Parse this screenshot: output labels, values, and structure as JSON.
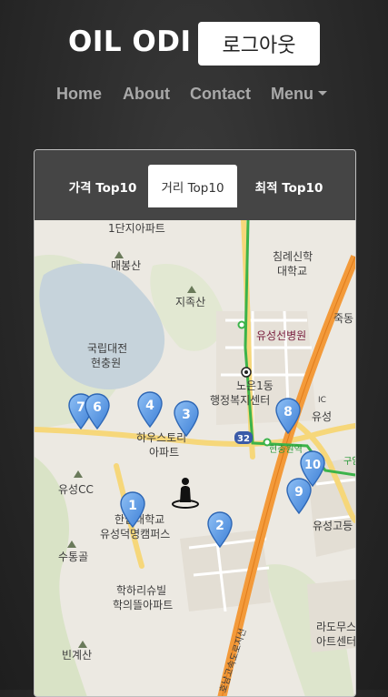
{
  "header": {
    "brand": "OIL ODI",
    "logout_label": "로그아웃"
  },
  "nav": {
    "items": [
      "Home",
      "About",
      "Contact"
    ],
    "menu_label": "Menu"
  },
  "tabs": [
    {
      "label": "가격 Top10",
      "active": false
    },
    {
      "label": "거리 Top10",
      "active": true
    },
    {
      "label": "최적 Top10",
      "active": false
    }
  ],
  "map": {
    "labels": {
      "apt_top": "1단지아파트",
      "mt_maebong": "매봉산",
      "mt_jijok": "지족산",
      "cemetery_1": "국립대전",
      "cemetery_2": "현충원",
      "seminary_1": "침례신학",
      "seminary_2": "대학교",
      "hospital": "유성선병원",
      "jukdong": "죽동",
      "noeun_1": "노은1동",
      "noeun_2": "행정복지센터",
      "ic": "IC",
      "yuseong": "유성",
      "haust_1": "하우스토리",
      "haust_2": "아파트",
      "road_num": "32",
      "station": "현충원역",
      "station2": "구암역",
      "yuseong_cc": "유성CC",
      "univ_1": "한밭대학교",
      "univ_2": "유성덕명캠퍼스",
      "sutonggol": "수통골",
      "hs": "유성고등",
      "hakhari_1": "학하리슈빌",
      "hakhari_2": "학의뜰아파트",
      "bingye": "빈계산",
      "expressway": "호남고속도로지선",
      "ladou_1": "라도무스",
      "ladou_2": "아트센터"
    },
    "markers": [
      "1",
      "2",
      "3",
      "4",
      "6",
      "7",
      "8",
      "9",
      "10"
    ],
    "user_icon": "person-location-icon"
  },
  "colors": {
    "tab_bg": "#454545",
    "active_tab": "#ffffff",
    "marker": "#4a8fe0",
    "highway": "#f39a3a"
  }
}
